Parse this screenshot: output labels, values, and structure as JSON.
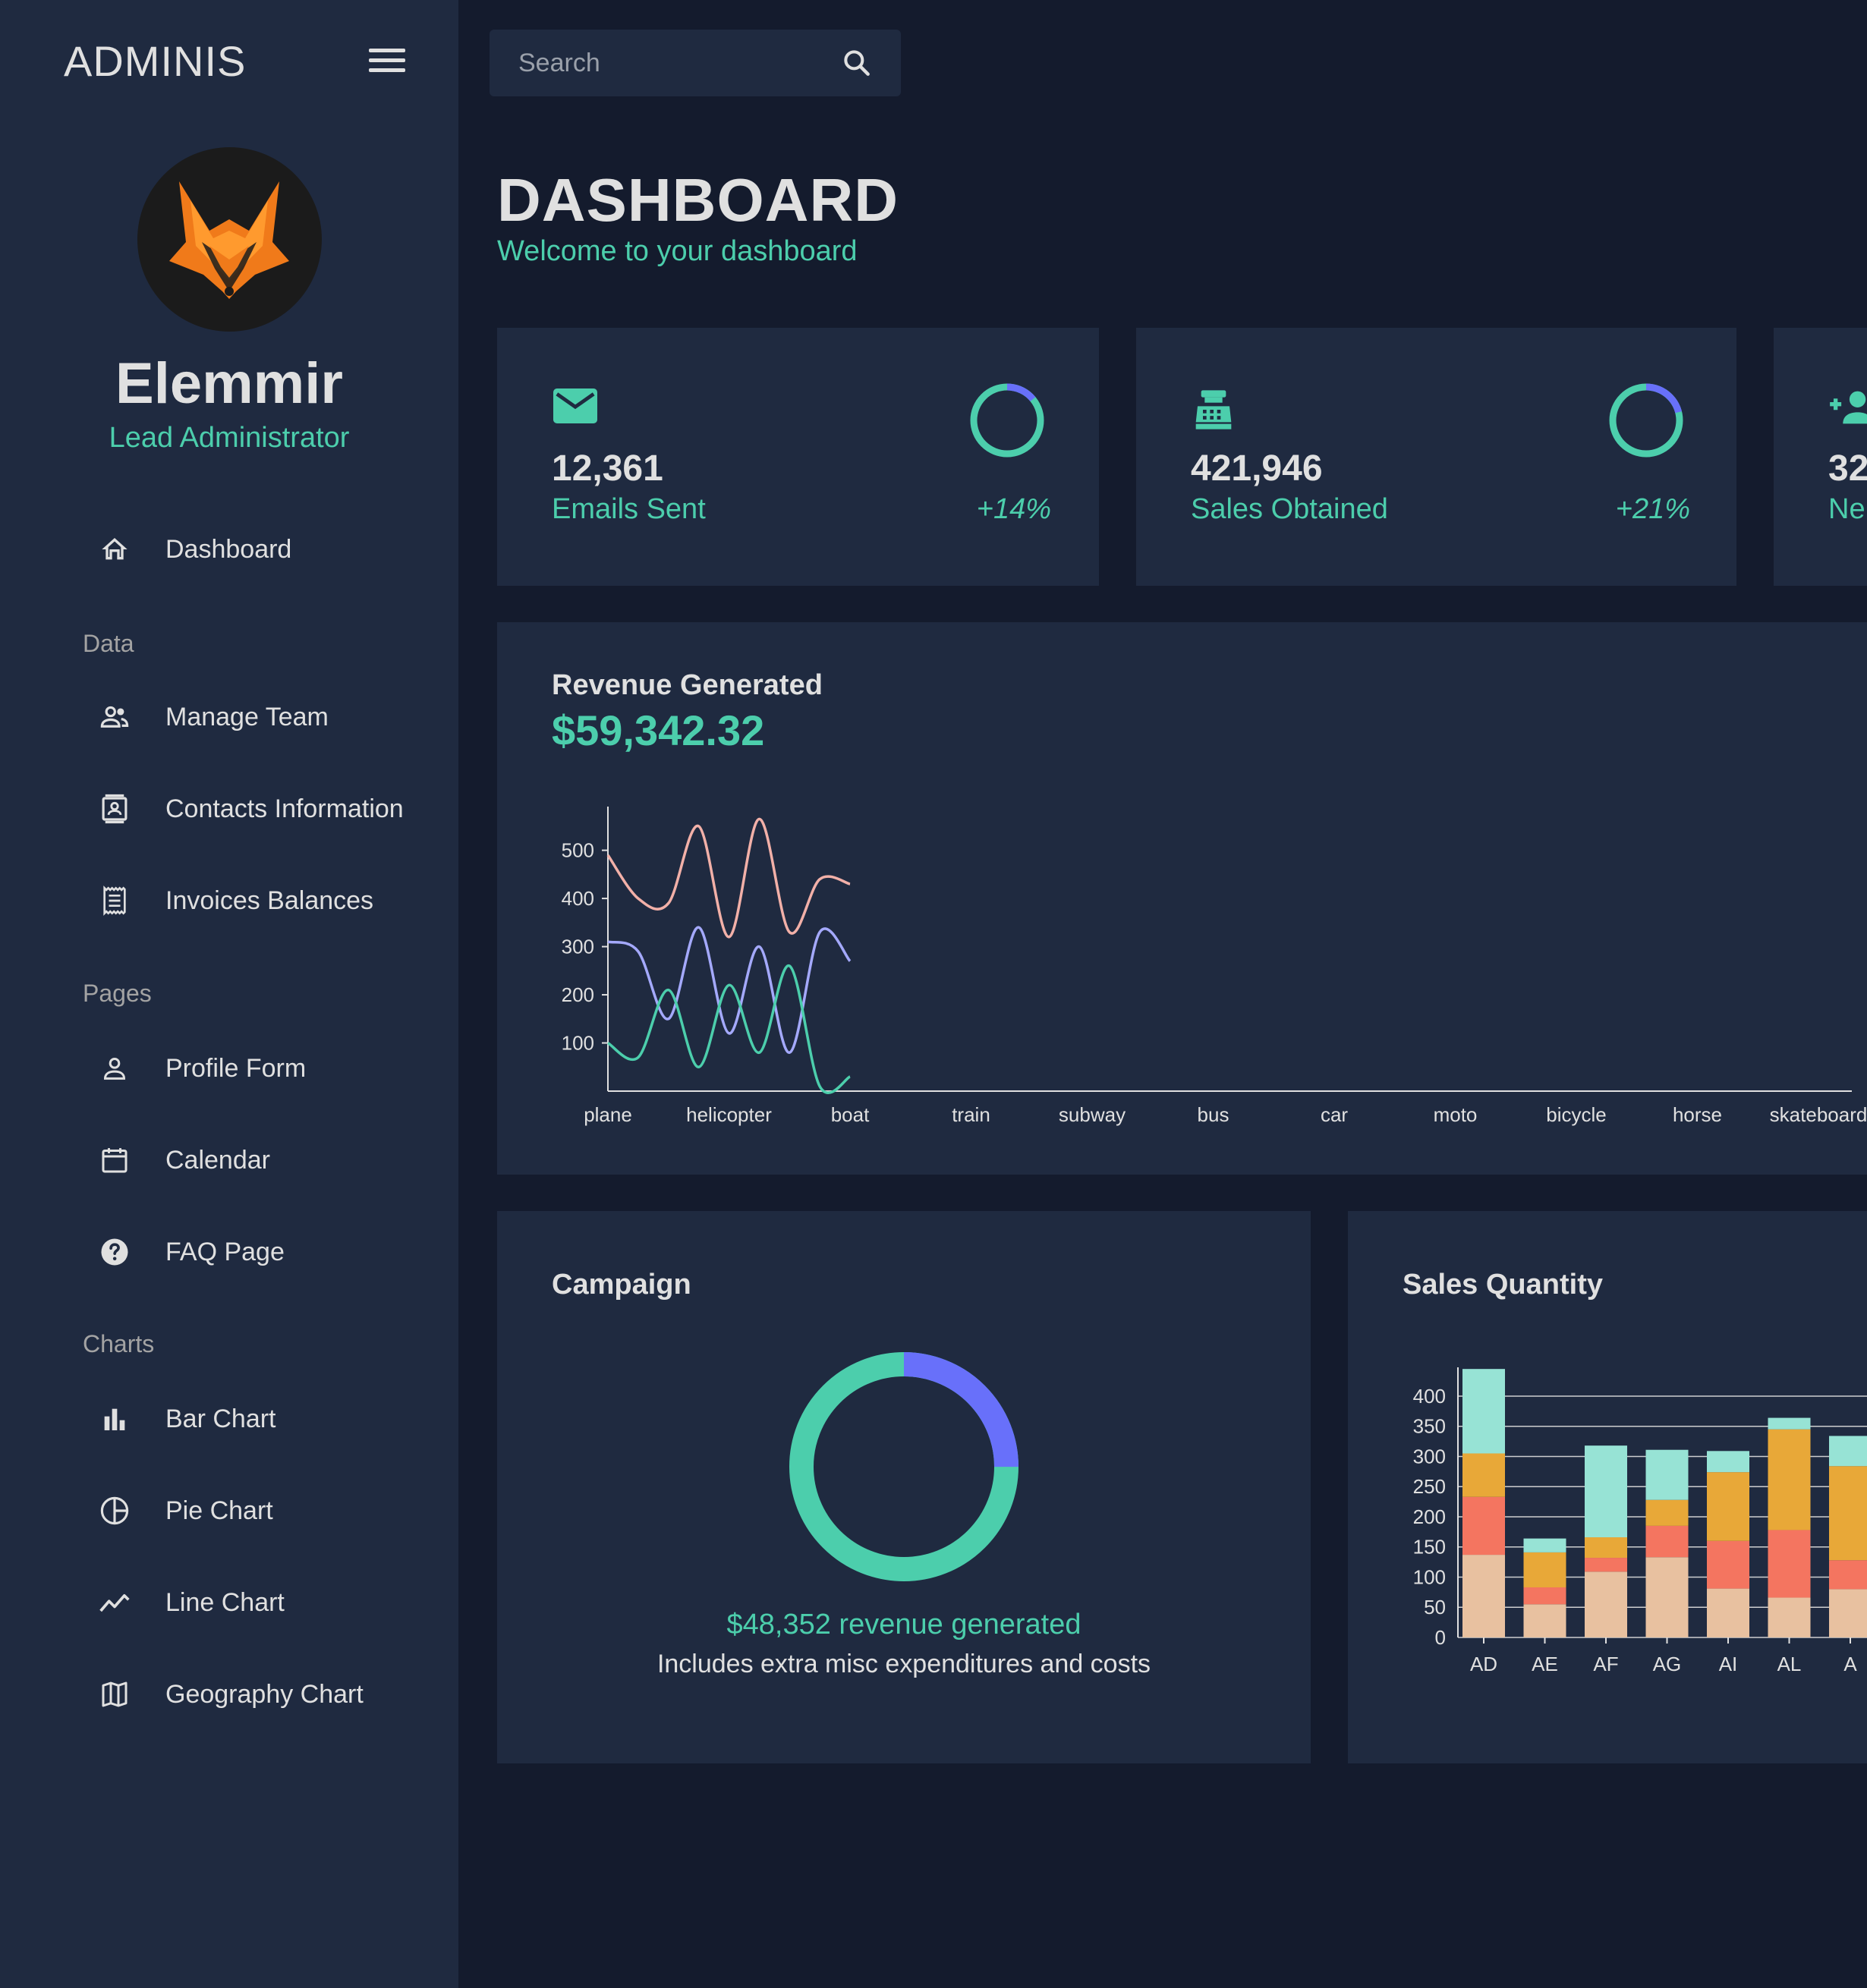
{
  "app": {
    "brand": "ADMINIS"
  },
  "user": {
    "name": "Elemmir",
    "role": "Lead Administrator"
  },
  "sidebar": {
    "items": [
      {
        "label": "Dashboard",
        "icon": "home-icon"
      },
      {
        "section": "Data"
      },
      {
        "label": "Manage Team",
        "icon": "people-icon"
      },
      {
        "label": "Contacts Information",
        "icon": "contacts-icon"
      },
      {
        "label": "Invoices Balances",
        "icon": "receipt-icon"
      },
      {
        "section": "Pages"
      },
      {
        "label": "Profile Form",
        "icon": "person-icon"
      },
      {
        "label": "Calendar",
        "icon": "calendar-icon"
      },
      {
        "label": "FAQ Page",
        "icon": "help-icon"
      },
      {
        "section": "Charts"
      },
      {
        "label": "Bar Chart",
        "icon": "bar-chart-icon"
      },
      {
        "label": "Pie Chart",
        "icon": "pie-chart-icon"
      },
      {
        "label": "Line Chart",
        "icon": "line-chart-icon"
      },
      {
        "label": "Geography Chart",
        "icon": "map-icon"
      }
    ]
  },
  "search": {
    "placeholder": "Search"
  },
  "header": {
    "title": "DASHBOARD",
    "subtitle": "Welcome to your dashboard"
  },
  "stats": [
    {
      "value": "12,361",
      "label": "Emails Sent",
      "delta": "+14%",
      "icon": "email-icon",
      "progress": 0.14
    },
    {
      "value": "421,946",
      "label": "Sales Obtained",
      "delta": "+21%",
      "icon": "point-of-sale-icon",
      "progress": 0.21
    },
    {
      "value": "32",
      "label": "Ne",
      "icon": "person-add-icon"
    }
  ],
  "revenue": {
    "title": "Revenue Generated",
    "amount": "$59,342.32"
  },
  "campaign": {
    "title": "Campaign",
    "amount_text": "$48,352 revenue generated",
    "note": "Includes extra misc expenditures and costs",
    "progress": 0.25
  },
  "sales": {
    "title": "Sales Quantity"
  },
  "colors": {
    "accent": "#4cceac",
    "indigo": "#6870fa",
    "bg": "#141b2d",
    "panel": "#1f2a40"
  },
  "chart_data": [
    {
      "type": "line",
      "categories": [
        "plane",
        "helicopter",
        "boat",
        "train",
        "subway",
        "bus",
        "car",
        "moto",
        "bicycle",
        "horse",
        "skateboard"
      ],
      "yticks": [
        100,
        200,
        300,
        400,
        500
      ],
      "ylim": [
        0,
        575
      ],
      "series": [
        {
          "color": "#f2b0a8",
          "values": [
            490,
            400,
            390,
            550,
            320,
            565,
            330,
            440,
            430
          ]
        },
        {
          "color": "#a4a9fc",
          "values": [
            310,
            290,
            150,
            340,
            120,
            300,
            80,
            330,
            270
          ]
        },
        {
          "color": "#4cceac",
          "values": [
            100,
            70,
            210,
            50,
            220,
            80,
            260,
            10,
            30
          ]
        }
      ]
    },
    {
      "type": "bar",
      "stacked": true,
      "categories": [
        "AD",
        "AE",
        "AF",
        "AG",
        "AI",
        "AL",
        "A"
      ],
      "yticks": [
        0,
        50,
        100,
        150,
        200,
        250,
        300,
        350,
        400
      ],
      "ylim": [
        0,
        410
      ],
      "series": [
        {
          "color": "#e8c1a0",
          "values": [
            137,
            55,
            109,
            133,
            81,
            66,
            80
          ]
        },
        {
          "color": "#f47560",
          "values": [
            96,
            28,
            23,
            52,
            79,
            112,
            48
          ]
        },
        {
          "color": "#e8a838",
          "values": [
            72,
            58,
            34,
            43,
            114,
            167,
            156
          ]
        },
        {
          "color": "#97e3d5",
          "values": [
            140,
            23,
            152,
            83,
            35,
            19,
            50
          ]
        }
      ]
    }
  ]
}
